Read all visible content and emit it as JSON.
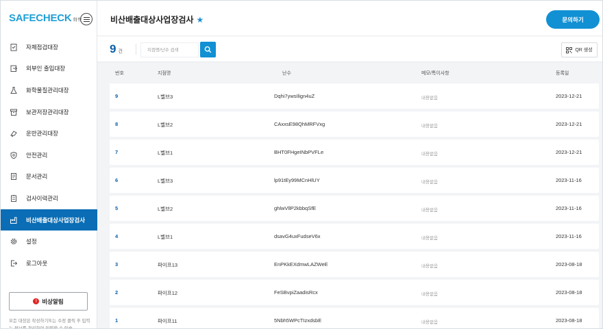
{
  "sidebar": {
    "logo_main": "SAFECHECK",
    "logo_sub": "화학",
    "items": [
      {
        "label": "자체점검대장",
        "icon": "clipboard-check-icon"
      },
      {
        "label": "외부인 출입대장",
        "icon": "door-enter-icon"
      },
      {
        "label": "화학물질관리대장",
        "icon": "flask-icon"
      },
      {
        "label": "보관저장관리대장",
        "icon": "archive-box-icon"
      },
      {
        "label": "운반관리대장",
        "icon": "transport-icon"
      },
      {
        "label": "안전관리",
        "icon": "shield-icon"
      },
      {
        "label": "문서관리",
        "icon": "document-icon"
      },
      {
        "label": "검사이력관리",
        "icon": "history-icon"
      },
      {
        "label": "비산배출대상사업장검사",
        "icon": "factory-icon",
        "active": true
      },
      {
        "label": "설정",
        "icon": "gear-icon"
      },
      {
        "label": "로그아웃",
        "icon": "logout-icon"
      }
    ],
    "emergency_label": "비상알림",
    "note": "모든 대장은 작성하기또는 수정 클릭 후 입력는 정보를 관리하여 입력할 수 있습"
  },
  "header": {
    "title": "비산배출대상사업장검사",
    "inquiry_label": "문의하기"
  },
  "toolbar": {
    "count": "9",
    "count_unit": "건",
    "search_placeholder": "지점명/난수 검색",
    "qr_label": "QR 생성"
  },
  "table": {
    "columns": [
      "번호",
      "지점명",
      "난수",
      "메모/특이사항",
      "등록일"
    ],
    "rows": [
      {
        "no": "9",
        "name": "L벨브3",
        "rand": "Dqhi7ywsIlign4uZ",
        "memo": "내용없음",
        "date": "2023-12-21"
      },
      {
        "no": "8",
        "name": "L벨브2",
        "rand": "CAxxsE98QhMRFVxg",
        "memo": "내용없음",
        "date": "2023-12-21"
      },
      {
        "no": "7",
        "name": "L벨브1",
        "rand": "BHT0FHgeINbPVFLe",
        "memo": "내용없음",
        "date": "2023-12-21"
      },
      {
        "no": "6",
        "name": "L벨브3",
        "rand": "lp91tEy99MCnHlUY",
        "memo": "내용없음",
        "date": "2023-11-16"
      },
      {
        "no": "5",
        "name": "L벨브2",
        "rand": "ghlwVllP2kbbqSfE",
        "memo": "내용없음",
        "date": "2023-11-16"
      },
      {
        "no": "4",
        "name": "L벨브1",
        "rand": "dsavG4uxFudseV6x",
        "memo": "내용없음",
        "date": "2023-11-16"
      },
      {
        "no": "3",
        "name": "파이프13",
        "rand": "EnPKkEXdmwLAZWeE",
        "memo": "내용없음",
        "date": "2023-08-18"
      },
      {
        "no": "2",
        "name": "파이프12",
        "rand": "FeSBvpiZaadisRcx",
        "memo": "내용없음",
        "date": "2023-08-18"
      },
      {
        "no": "1",
        "name": "파이프11",
        "rand": "5Nbh5WPcTIzxdsbE",
        "memo": "내용없음",
        "date": "2023-08-18"
      }
    ]
  },
  "colors": {
    "accent": "#1190d4",
    "active_nav": "#0a6db5",
    "count": "#0a5fa8",
    "emergency": "#e02424"
  }
}
